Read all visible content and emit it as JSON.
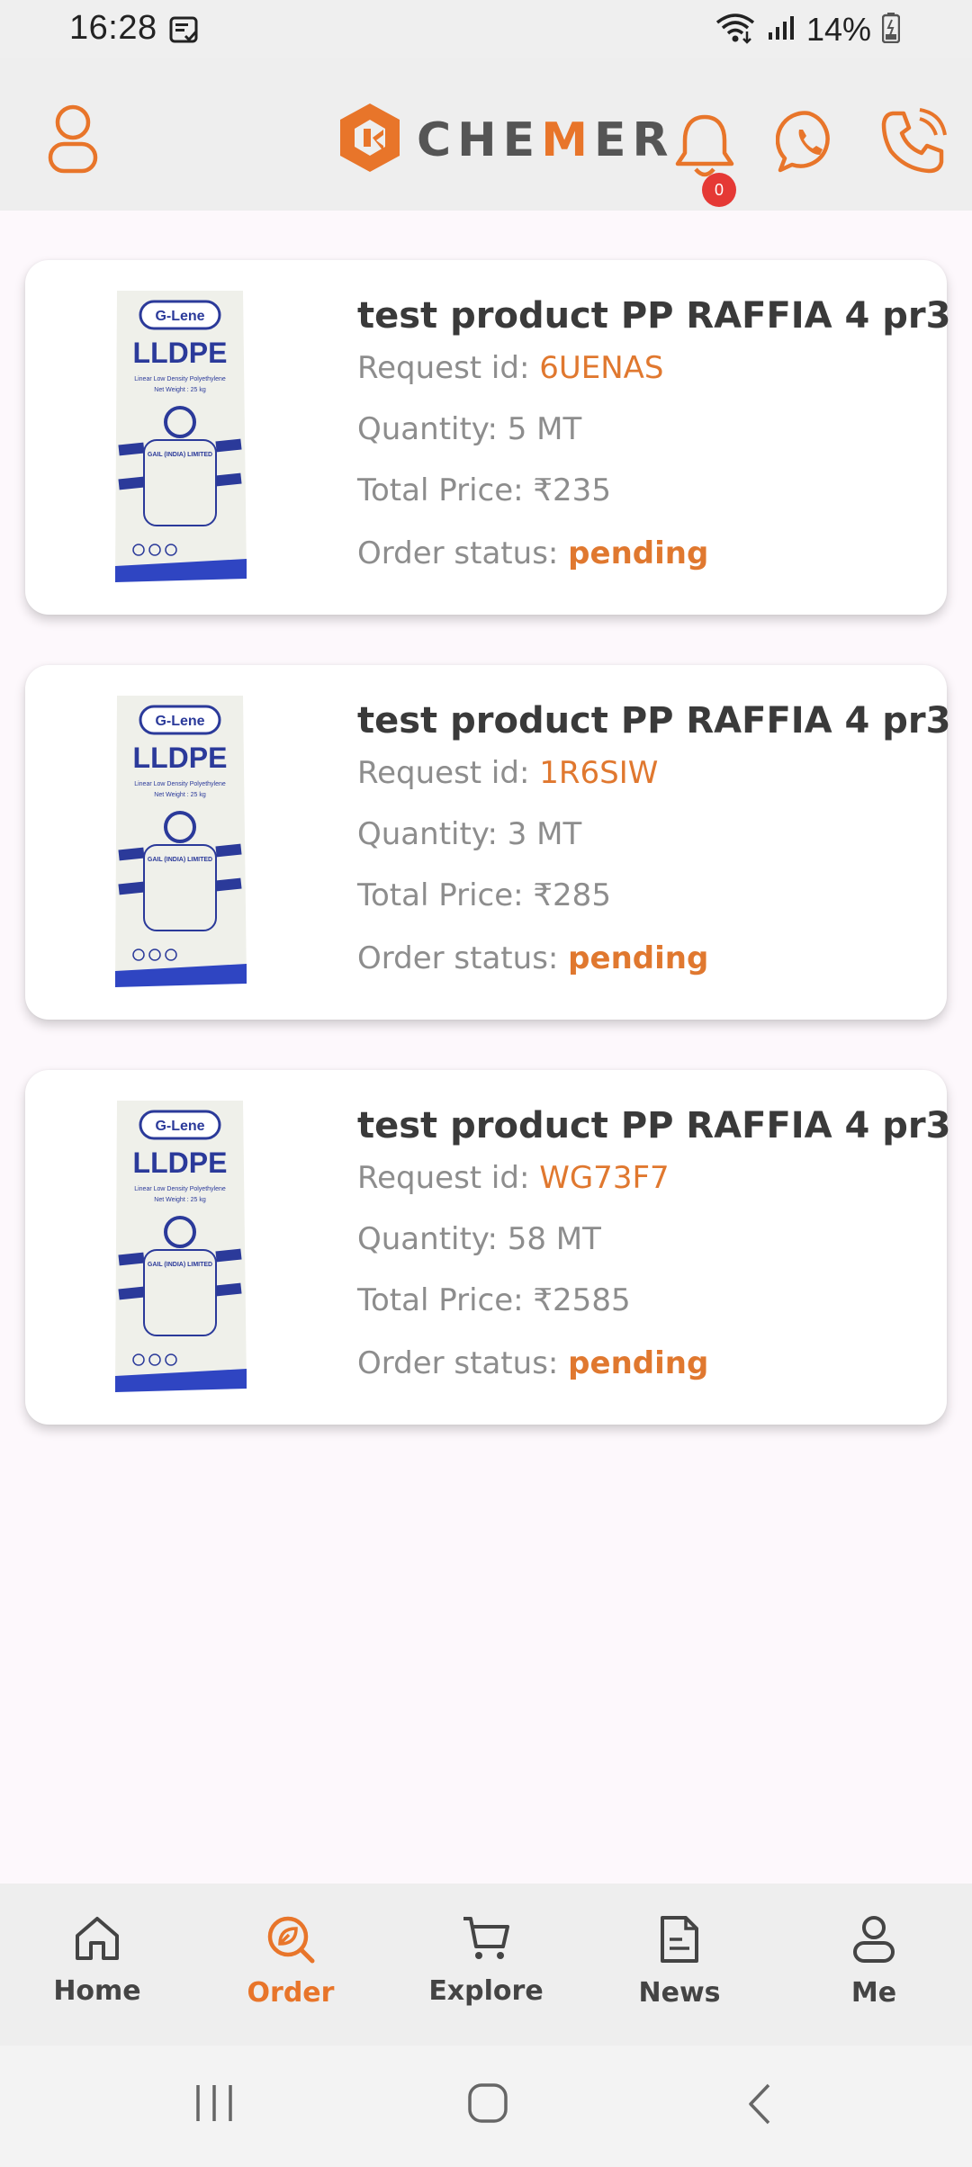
{
  "status_bar": {
    "time": "16:28",
    "battery": "14%",
    "icons": [
      "notification-app-icon",
      "wifi-icon",
      "signal-icon",
      "battery-icon"
    ]
  },
  "header": {
    "brand_prefix": "CHE",
    "brand_accent": "M",
    "brand_suffix": "ER",
    "notification_count": "0",
    "accent_color": "#e8752a"
  },
  "orders": [
    {
      "title": "test product PP RAFFIA 4 pr3",
      "request_label": "Request id: ",
      "request_id": "6UENAS",
      "quantity": "Quantity: 5 MT",
      "price_label": "Total Price: ",
      "price": "₹235",
      "status_label": "Order status: ",
      "status": "pending",
      "image_text": {
        "brand": "G-Lene",
        "product": "LLDPE",
        "desc": "Linear Low Density Polyethylene",
        "weight": "Net Weight : 25 kg",
        "maker": "GAIL (INDIA) LIMITED"
      }
    },
    {
      "title": "test product PP RAFFIA 4 pr3",
      "request_label": "Request id: ",
      "request_id": "1R6SIW",
      "quantity": "Quantity: 3 MT",
      "price_label": "Total Price: ",
      "price": "₹285",
      "status_label": "Order status: ",
      "status": "pending",
      "image_text": {
        "brand": "G-Lene",
        "product": "LLDPE",
        "desc": "Linear Low Density Polyethylene",
        "weight": "Net Weight : 25 kg",
        "maker": "GAIL (INDIA) LIMITED"
      }
    },
    {
      "title": "test product PP RAFFIA 4 pr3",
      "request_label": "Request id: ",
      "request_id": "WG73F7",
      "quantity": "Quantity: 58 MT",
      "price_label": "Total Price: ",
      "price": "₹2585",
      "status_label": "Order status: ",
      "status": "pending",
      "image_text": {
        "brand": "G-Lene",
        "product": "LLDPE",
        "desc": "Linear Low Density Polyethylene",
        "weight": "Net Weight : 25 kg",
        "maker": "GAIL (INDIA) LIMITED"
      }
    }
  ],
  "bottom_nav": {
    "items": [
      {
        "label": "Home",
        "icon": "home-icon"
      },
      {
        "label": "Order",
        "icon": "order-icon",
        "active": true
      },
      {
        "label": "Explore",
        "icon": "cart-icon"
      },
      {
        "label": "News",
        "icon": "document-icon"
      },
      {
        "label": "Me",
        "icon": "person-icon"
      }
    ]
  },
  "system_nav": {
    "icons": [
      "recents-icon",
      "home-circle-icon",
      "back-icon"
    ]
  }
}
